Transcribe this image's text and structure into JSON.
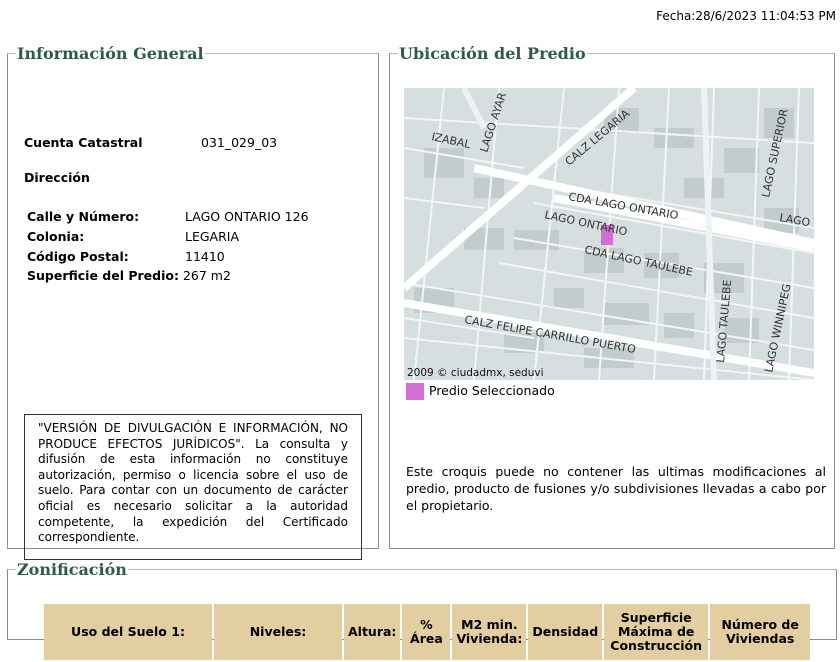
{
  "fecha": "Fecha:28/6/2023 11:04:53 PM",
  "info": {
    "legend": "Información General",
    "cuenta_label": "Cuenta Catastral",
    "cuenta_value": "031_029_03",
    "direccion_label": "Dirección",
    "fields": [
      {
        "label": "Calle y Número:",
        "value": "LAGO ONTARIO 126"
      },
      {
        "label": "Colonia:",
        "value": "LEGARIA"
      },
      {
        "label": "Código Postal:",
        "value": "11410"
      },
      {
        "label": "Superficie del Predio:",
        "value": "267 m2"
      }
    ],
    "disclaimer": "\"VERSIÓN DE DIVULGACIÓN E INFORMACIÓN, NO PRODUCE EFECTOS JURÍDICOS\". La consulta y difusión de esta información no constituye autorización, permiso o licencia sobre el uso de suelo. Para contar con un documento de carácter oficial es necesario solicitar a la autoridad competente, la expedición del Certificado correspondiente."
  },
  "ubicacion": {
    "legend": "Ubicación del Predio",
    "map_labels": {
      "izabal": "IZABAL",
      "lago_ayar": "LAGO AYAR",
      "calz_legaria": "CALZ LEGARIA",
      "lago_superior": "LAGO SUPERIOR",
      "cda_lago_ontario": "CDA LAGO ONTARIO",
      "lago_e": "LAGO E",
      "lago_ontario": "LAGO ONTARIO",
      "cda_lago_taulebe": "CDA LAGO TAULEBE",
      "lago_taulebe": "LAGO TAULEBE",
      "lago_winnipeg": "LAGO WINNIPEG",
      "calz_felipe": "CALZ FELIPE CARRILLO PUERTO",
      "copyright": "2009 © ciudadmx, seduvi"
    },
    "legend_item": "Predio Seleccionado",
    "highlight_color": "#d56ed4",
    "note": "Este croquis puede no contener las ultimas modificaciones al predio, producto de fusiones y/o subdivisiones llevadas a cabo por el propietario."
  },
  "zonificacion": {
    "legend": "Zonificación",
    "headers": [
      "Uso del Suelo 1:",
      "Niveles:",
      "Altura:",
      "% Área",
      "M2 min. Vivienda:",
      "Densidad",
      "Superficie Máxima de Construcción",
      "Número de Viviendas"
    ]
  }
}
